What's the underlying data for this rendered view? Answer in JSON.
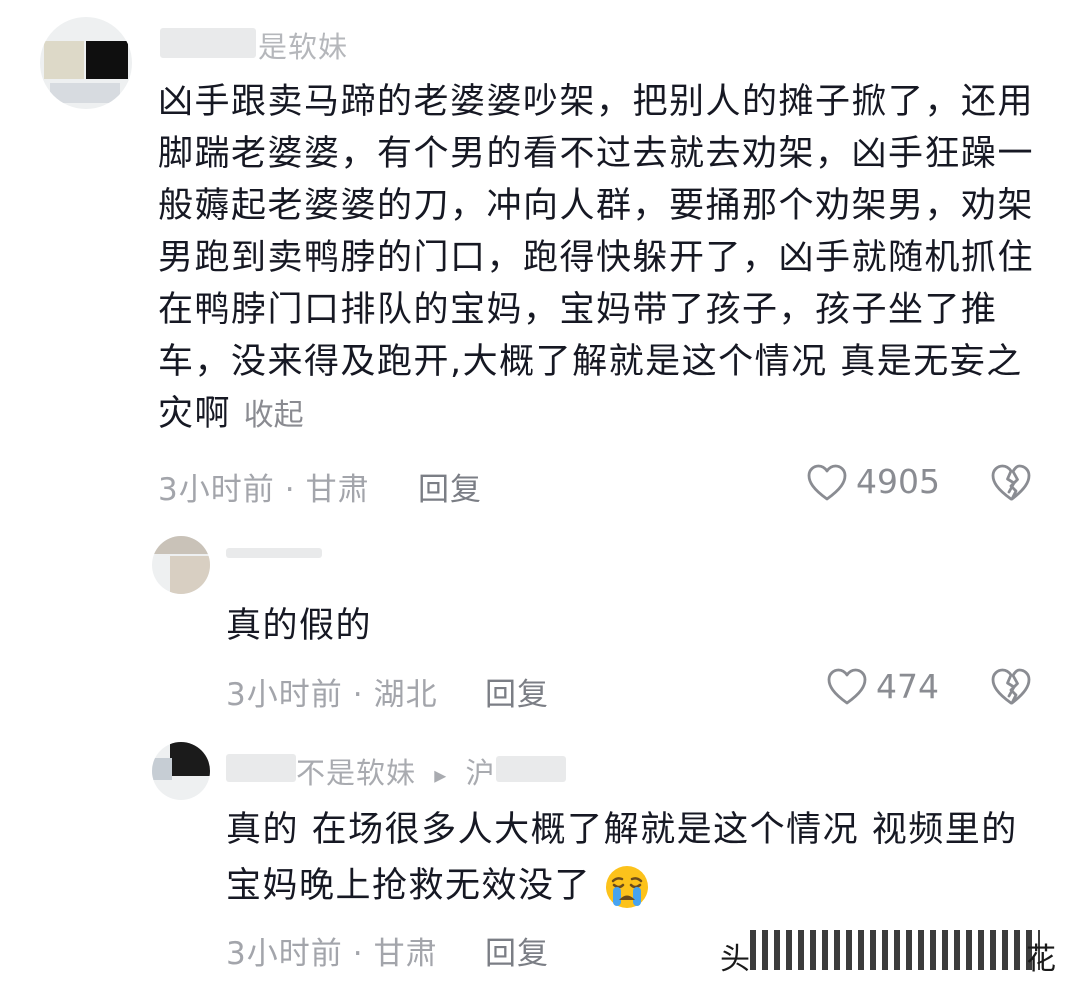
{
  "comments": [
    {
      "username": "是软妹",
      "text": "凶手跟卖马蹄的老婆婆吵架，把别人的摊子掀了，还用脚踹老婆婆，有个男的看不过去就去劝架，凶手狂躁一般薅起老婆婆的刀，冲向人群，要捅那个劝架男，劝架男跑到卖鸭脖的门口，跑得快躲开了，凶手就随机抓住在鸭脖门口排队的宝妈，宝妈带了孩子，孩子坐了推车，没来得及跑开,大概了解就是这个情况 真是无妄之灾啊",
      "collapse_label": "收起",
      "time": "3小时前",
      "location": "甘肃",
      "reply_label": "回复",
      "likes": "4905",
      "like_icon": "heart-outline-icon",
      "dislike_icon": "broken-heart-icon"
    }
  ],
  "replies": [
    {
      "text": "真的假的",
      "time": "3小时前",
      "location": "湖北",
      "reply_label": "回复",
      "likes": "474"
    },
    {
      "username": "不是软妹",
      "reply_arrow": "▸",
      "reply_to": "沪",
      "text": "真的 在场很多人大概了解就是这个情况 视频里的宝妈晚上抢救无效没了",
      "emoji": "crying-face-emoji",
      "time": "3小时前",
      "location": "甘肃",
      "reply_label": "回复"
    }
  ],
  "meta_separator": "·",
  "watermark": {
    "left": "头",
    "right": "花"
  },
  "colors": {
    "text": "#161823",
    "meta": "#a3a5ab",
    "icon": "#8a8c92"
  }
}
